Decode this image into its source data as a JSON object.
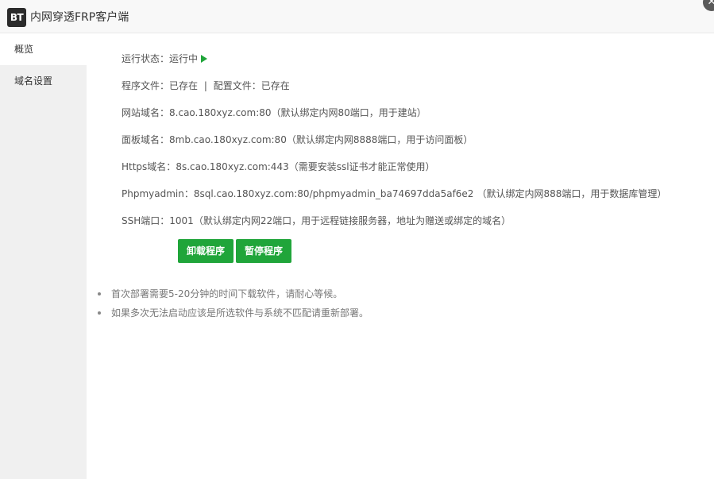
{
  "window": {
    "logo_text": "BT",
    "title": "内网穿透FRP客户端",
    "close_symbol": "✕"
  },
  "sidebar": {
    "items": [
      {
        "label": "概览",
        "active": true
      },
      {
        "label": "域名设置",
        "active": false
      }
    ]
  },
  "overview": {
    "status_label": "运行状态：",
    "status_value": "运行中",
    "program_file_label": "程序文件：",
    "program_file_value": "已存在",
    "separator": "|",
    "config_file_label": "配置文件：",
    "config_file_value": "已存在",
    "site_domain_label": "网站域名：",
    "site_domain_value": "8.cao.180xyz.com:80",
    "site_domain_note": "（默认绑定内网80端口，用于建站）",
    "panel_domain_label": "面板域名：",
    "panel_domain_value": "8mb.cao.180xyz.com:80",
    "panel_domain_note": "（默认绑定内网8888端口，用于访问面板）",
    "https_domain_label": "Https域名：",
    "https_domain_value": "8s.cao.180xyz.com:443",
    "https_domain_note": "（需要安装ssl证书才能正常使用）",
    "phpmyadmin_label": "Phpmyadmin：",
    "phpmyadmin_value": "8sql.cao.180xyz.com:80/phpmyadmin_ba74697dda5af6e2",
    "phpmyadmin_note": "（默认绑定内网888端口，用于数据库管理）",
    "ssh_label": "SSH端口：",
    "ssh_value": "1001",
    "ssh_note": "（默认绑定内网22端口，用于远程链接服务器，地址为赠送或绑定的域名）"
  },
  "actions": {
    "uninstall_label": "卸载程序",
    "pause_label": "暂停程序"
  },
  "tips": [
    "首次部署需要5-20分钟的时间下载软件，请耐心等候。",
    "如果多次无法启动应该是所选软件与系统不匹配请重新部署。"
  ],
  "colors": {
    "accent_green": "#20a53a",
    "sidebar_bg": "#f0f0f0",
    "titlebar_bg": "#f8f8f8"
  }
}
